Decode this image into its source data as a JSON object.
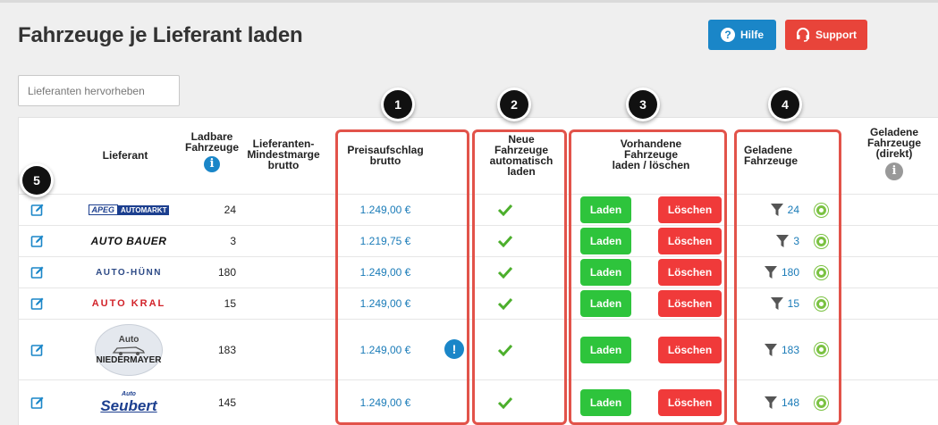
{
  "page": {
    "title": "Fahrzeuge je Lieferant laden"
  },
  "header": {
    "help_label": "Hilfe",
    "support_label": "Support"
  },
  "search": {
    "placeholder": "Lieferanten hervorheben"
  },
  "columns": {
    "supplier": "Lieferant",
    "loadable": [
      "Ladbare",
      "Fahrzeuge"
    ],
    "min_margin": [
      "Lieferanten-",
      "Mindestmarge",
      "brutto"
    ],
    "markup": [
      "Preisaufschlag",
      "brutto"
    ],
    "new_vehicles": [
      "Neue",
      "Fahrzeuge",
      "automatisch",
      "laden"
    ],
    "existing": [
      "Vorhandene",
      "Fahrzeuge",
      "laden / löschen"
    ],
    "loaded": [
      "Geladene",
      "Fahrzeuge"
    ],
    "loaded_direct": [
      "Geladene",
      "Fahrzeuge",
      "(direkt)"
    ]
  },
  "buttons": {
    "load": "Laden",
    "delete": "Löschen"
  },
  "rows": [
    {
      "supplier": "APEG AUTOMARKT",
      "logo_parts": [
        "APEG",
        "AUTOMARKT"
      ],
      "loadable": "24",
      "markup": "1.249,00 €",
      "auto_load": true,
      "loaded": "24"
    },
    {
      "supplier": "AUTO BAUER",
      "logo_parts": [
        "AUTO BAUER"
      ],
      "loadable": "3",
      "markup": "1.219,75 €",
      "auto_load": true,
      "loaded": "3"
    },
    {
      "supplier": "AUTO-HÜNN",
      "logo_parts": [
        "AUTO-HÜNN"
      ],
      "loadable": "180",
      "markup": "1.249,00 €",
      "auto_load": true,
      "loaded": "180"
    },
    {
      "supplier": "AUTO KRAL",
      "logo_parts": [
        "AUTO KRAL"
      ],
      "loadable": "15",
      "markup": "1.249,00 €",
      "auto_load": true,
      "loaded": "15"
    },
    {
      "supplier": "Auto NIEDERMAYER",
      "logo_parts": [
        "Auto",
        "NIEDERMAYER"
      ],
      "loadable": "183",
      "markup": "1.249,00 €",
      "auto_load": true,
      "loaded": "183",
      "warning": "!"
    },
    {
      "supplier": "Auto Seubert",
      "logo_parts": [
        "Auto",
        "Seubert"
      ],
      "loadable": "145",
      "markup": "1.249,00 €",
      "auto_load": true,
      "loaded": "148"
    }
  ],
  "markers": [
    "1",
    "2",
    "3",
    "4",
    "5"
  ],
  "colors": {
    "accent": "#1a86c8",
    "danger": "#e8443a",
    "success": "#2ec43c",
    "highlight_box": "#e2534a"
  }
}
